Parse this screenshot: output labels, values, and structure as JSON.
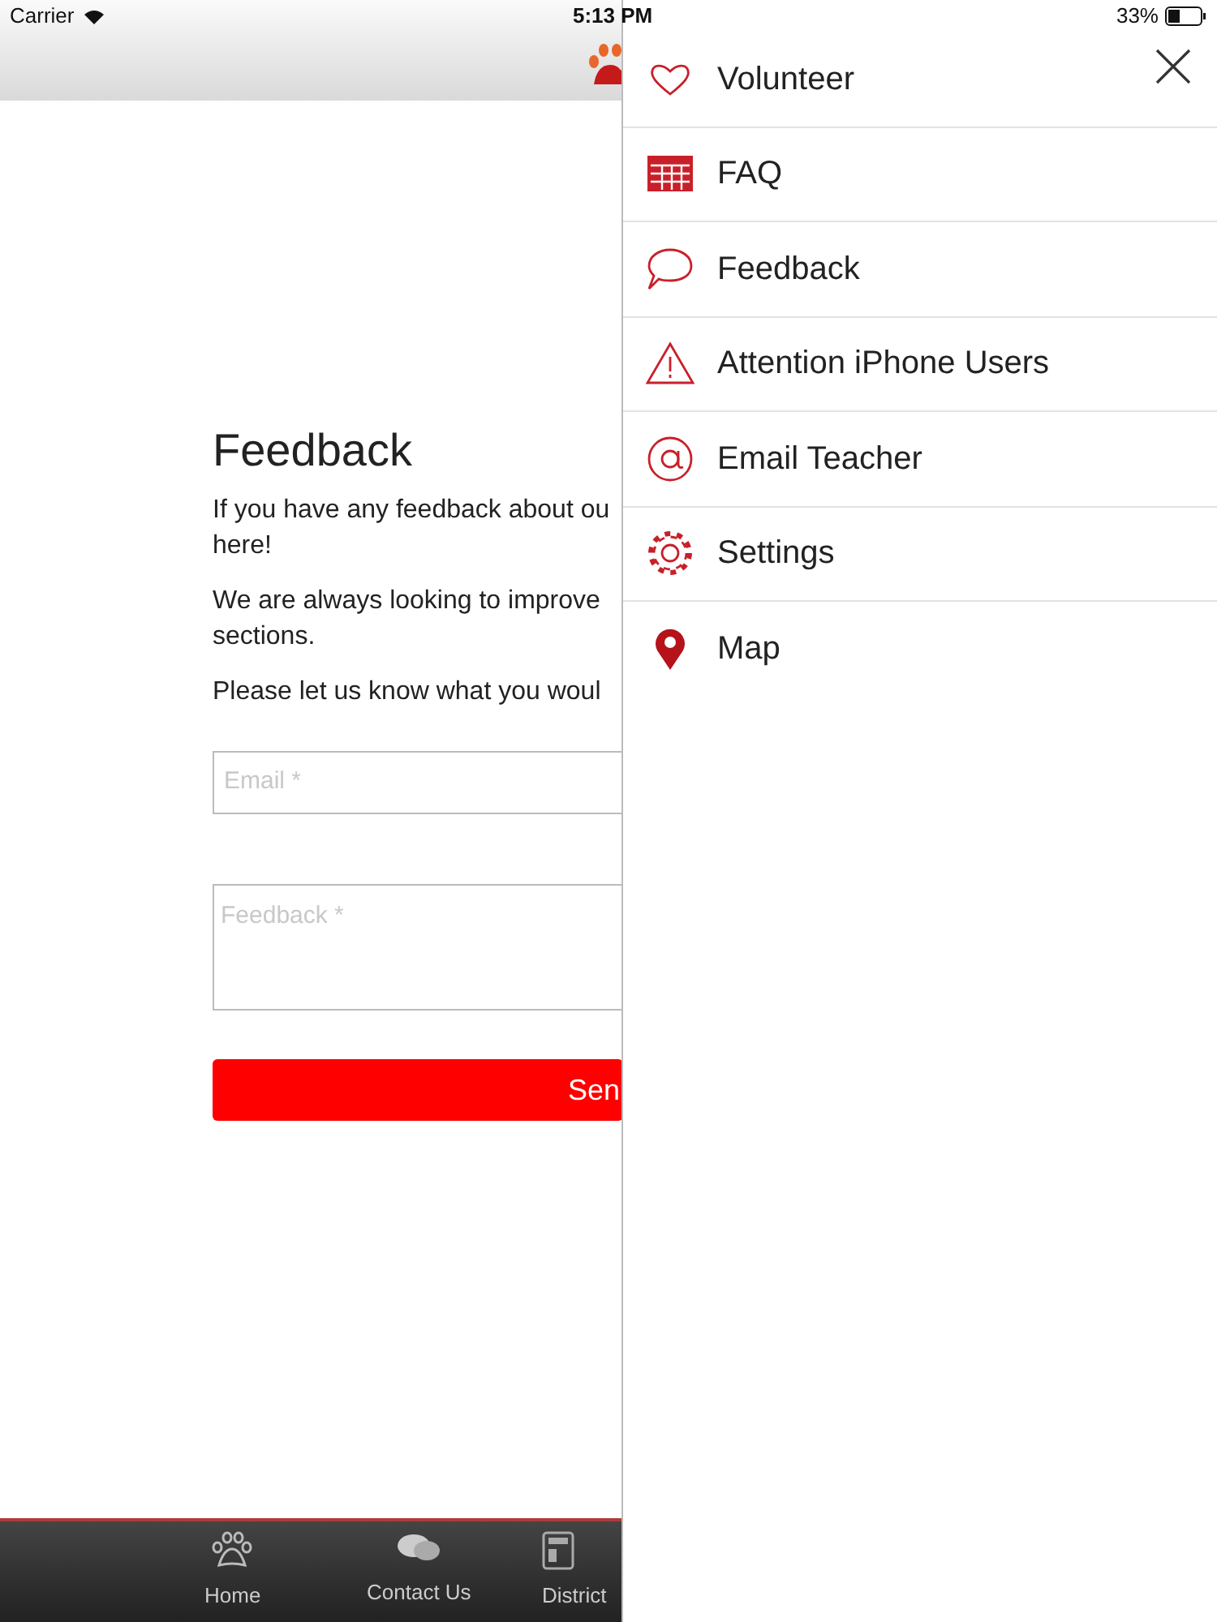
{
  "status_bar": {
    "carrier": "Carrier",
    "time": "5:13 PM",
    "battery": "33%"
  },
  "page": {
    "title": "Feedback",
    "paragraphs": [
      [
        "If you have any feedback about ou",
        "here!"
      ],
      [
        "We are always looking to improve",
        "sections."
      ],
      [
        "Please let us know what you woul"
      ]
    ],
    "email_field": {
      "placeholder": "Email *"
    },
    "feedback_field": {
      "placeholder": "Feedback *"
    },
    "send_button": "Sen"
  },
  "tab_bar": [
    {
      "label": "Home"
    },
    {
      "label": "Contact Us"
    },
    {
      "label": "District"
    }
  ],
  "menu": {
    "items": [
      {
        "label": "Volunteer"
      },
      {
        "label": "FAQ"
      },
      {
        "label": "Feedback"
      },
      {
        "label": "Attention iPhone Users"
      },
      {
        "label": "Email Teacher"
      },
      {
        "label": "Settings"
      },
      {
        "label": "Map"
      }
    ]
  }
}
